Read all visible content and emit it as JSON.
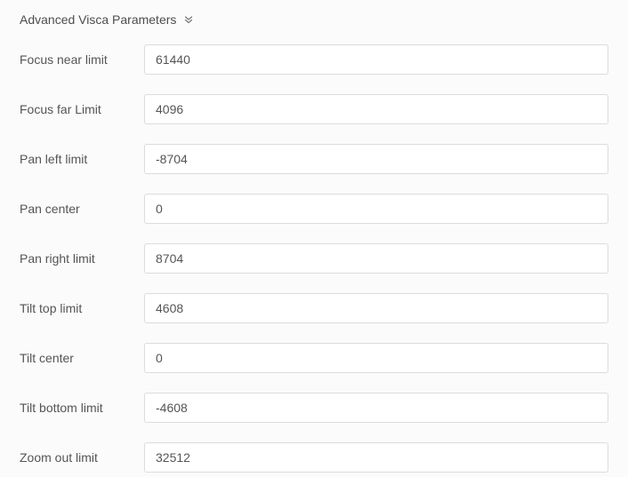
{
  "section": {
    "title": "Advanced Visca Parameters"
  },
  "fields": {
    "focus_near_limit": {
      "label": "Focus near limit",
      "value": "61440"
    },
    "focus_far_limit": {
      "label": "Focus far Limit",
      "value": "4096"
    },
    "pan_left_limit": {
      "label": "Pan left limit",
      "value": "-8704"
    },
    "pan_center": {
      "label": "Pan center",
      "value": "0"
    },
    "pan_right_limit": {
      "label": "Pan right limit",
      "value": "8704"
    },
    "tilt_top_limit": {
      "label": "Tilt top limit",
      "value": "4608"
    },
    "tilt_center": {
      "label": "Tilt center",
      "value": "0"
    },
    "tilt_bottom_limit": {
      "label": "Tilt bottom limit",
      "value": "-4608"
    },
    "zoom_out_limit": {
      "label": "Zoom out limit",
      "value": "32512"
    }
  }
}
